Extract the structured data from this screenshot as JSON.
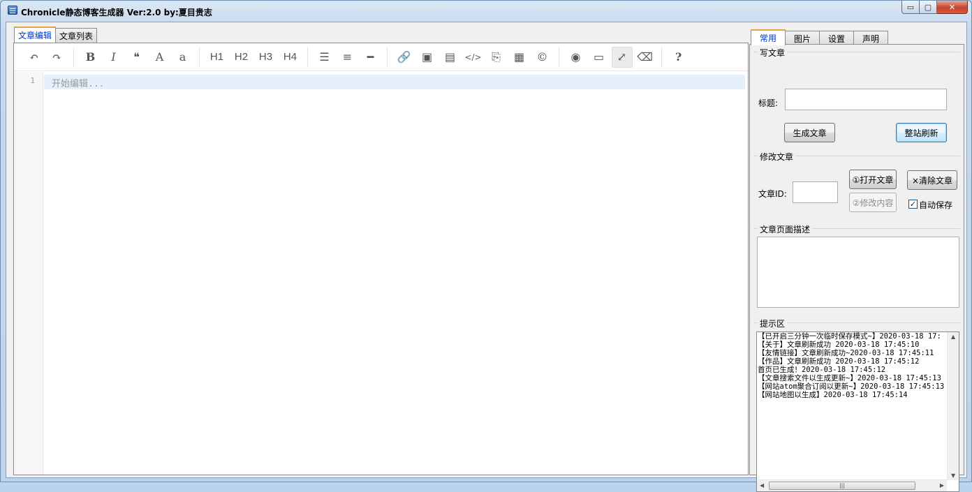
{
  "window": {
    "title": "Chronicle静态博客生成器 Ver:2.0    by:夏目贵志",
    "controls": {
      "minimize": "▭",
      "maximize": "▢",
      "close": "✕"
    }
  },
  "left_tabs": [
    {
      "label": "文章编辑",
      "active": true
    },
    {
      "label": "文章列表",
      "active": false
    }
  ],
  "editor": {
    "toolbar": [
      {
        "name": "undo-icon",
        "glyph": "↶"
      },
      {
        "name": "redo-icon",
        "glyph": "↷"
      },
      {
        "name": "bold-icon",
        "glyph": "B"
      },
      {
        "name": "italic-icon",
        "glyph": "I"
      },
      {
        "name": "quote-icon",
        "glyph": "❝"
      },
      {
        "name": "uppercase-icon",
        "glyph": "A"
      },
      {
        "name": "lowercase-icon",
        "glyph": "a"
      },
      {
        "name": "h1-icon",
        "glyph": "H1"
      },
      {
        "name": "h2-icon",
        "glyph": "H2"
      },
      {
        "name": "h3-icon",
        "glyph": "H3"
      },
      {
        "name": "h4-icon",
        "glyph": "H4"
      },
      {
        "name": "unordered-list-icon",
        "glyph": "☰"
      },
      {
        "name": "ordered-list-icon",
        "glyph": "≡"
      },
      {
        "name": "horizontal-rule-icon",
        "glyph": "━"
      },
      {
        "name": "link-icon",
        "glyph": "🔗"
      },
      {
        "name": "image-icon",
        "glyph": "▣"
      },
      {
        "name": "file-image-icon",
        "glyph": "▤"
      },
      {
        "name": "code-icon",
        "glyph": "</>"
      },
      {
        "name": "code-file-icon",
        "glyph": "⎘"
      },
      {
        "name": "table-icon",
        "glyph": "▦"
      },
      {
        "name": "copyright-icon",
        "glyph": "©"
      },
      {
        "name": "preview-icon",
        "glyph": "◉"
      },
      {
        "name": "desktop-icon",
        "glyph": "▭"
      },
      {
        "name": "fullscreen-icon",
        "glyph": "⤢"
      },
      {
        "name": "eraser-icon",
        "glyph": "⌫"
      },
      {
        "name": "help-icon",
        "glyph": "?"
      }
    ],
    "line_number": "1",
    "placeholder": "开始编辑..."
  },
  "right_tabs": [
    {
      "label": "常用",
      "active": true
    },
    {
      "label": "图片",
      "active": false
    },
    {
      "label": "设置",
      "active": false
    },
    {
      "label": "声明",
      "active": false
    }
  ],
  "write_article": {
    "group_label": "写文章",
    "title_label": "标题:",
    "title_value": "",
    "generate_button": "生成文章",
    "refresh_button": "整站刷新"
  },
  "edit_article": {
    "group_label": "修改文章",
    "id_label": "文章ID:",
    "id_value": "",
    "open_button": "①打开文章",
    "clear_button": "×清除文章",
    "modify_button": "②修改内容",
    "autosave_label": "自动保存",
    "autosave_checked": true
  },
  "description": {
    "group_label": "文章页面描述",
    "value": ""
  },
  "log": {
    "group_label": "提示区",
    "lines": [
      "【已开启三分钟一次临时保存模式~】2020-03-18 17:",
      "【关于】文章刷新成功 2020-03-18 17:45:10",
      "【友情链接】文章刷新成功~2020-03-18 17:45:11",
      "【作品】文章刷新成功 2020-03-18 17:45:12",
      "首页已生成！2020-03-18 17:45:12",
      "【文章搜索文件以生成更新~】2020-03-18 17:45:13",
      "【网站atom聚合订阅以更新~】2020-03-18 17:45:13",
      "【网站地图以生成】2020-03-18 17:45:14"
    ]
  }
}
